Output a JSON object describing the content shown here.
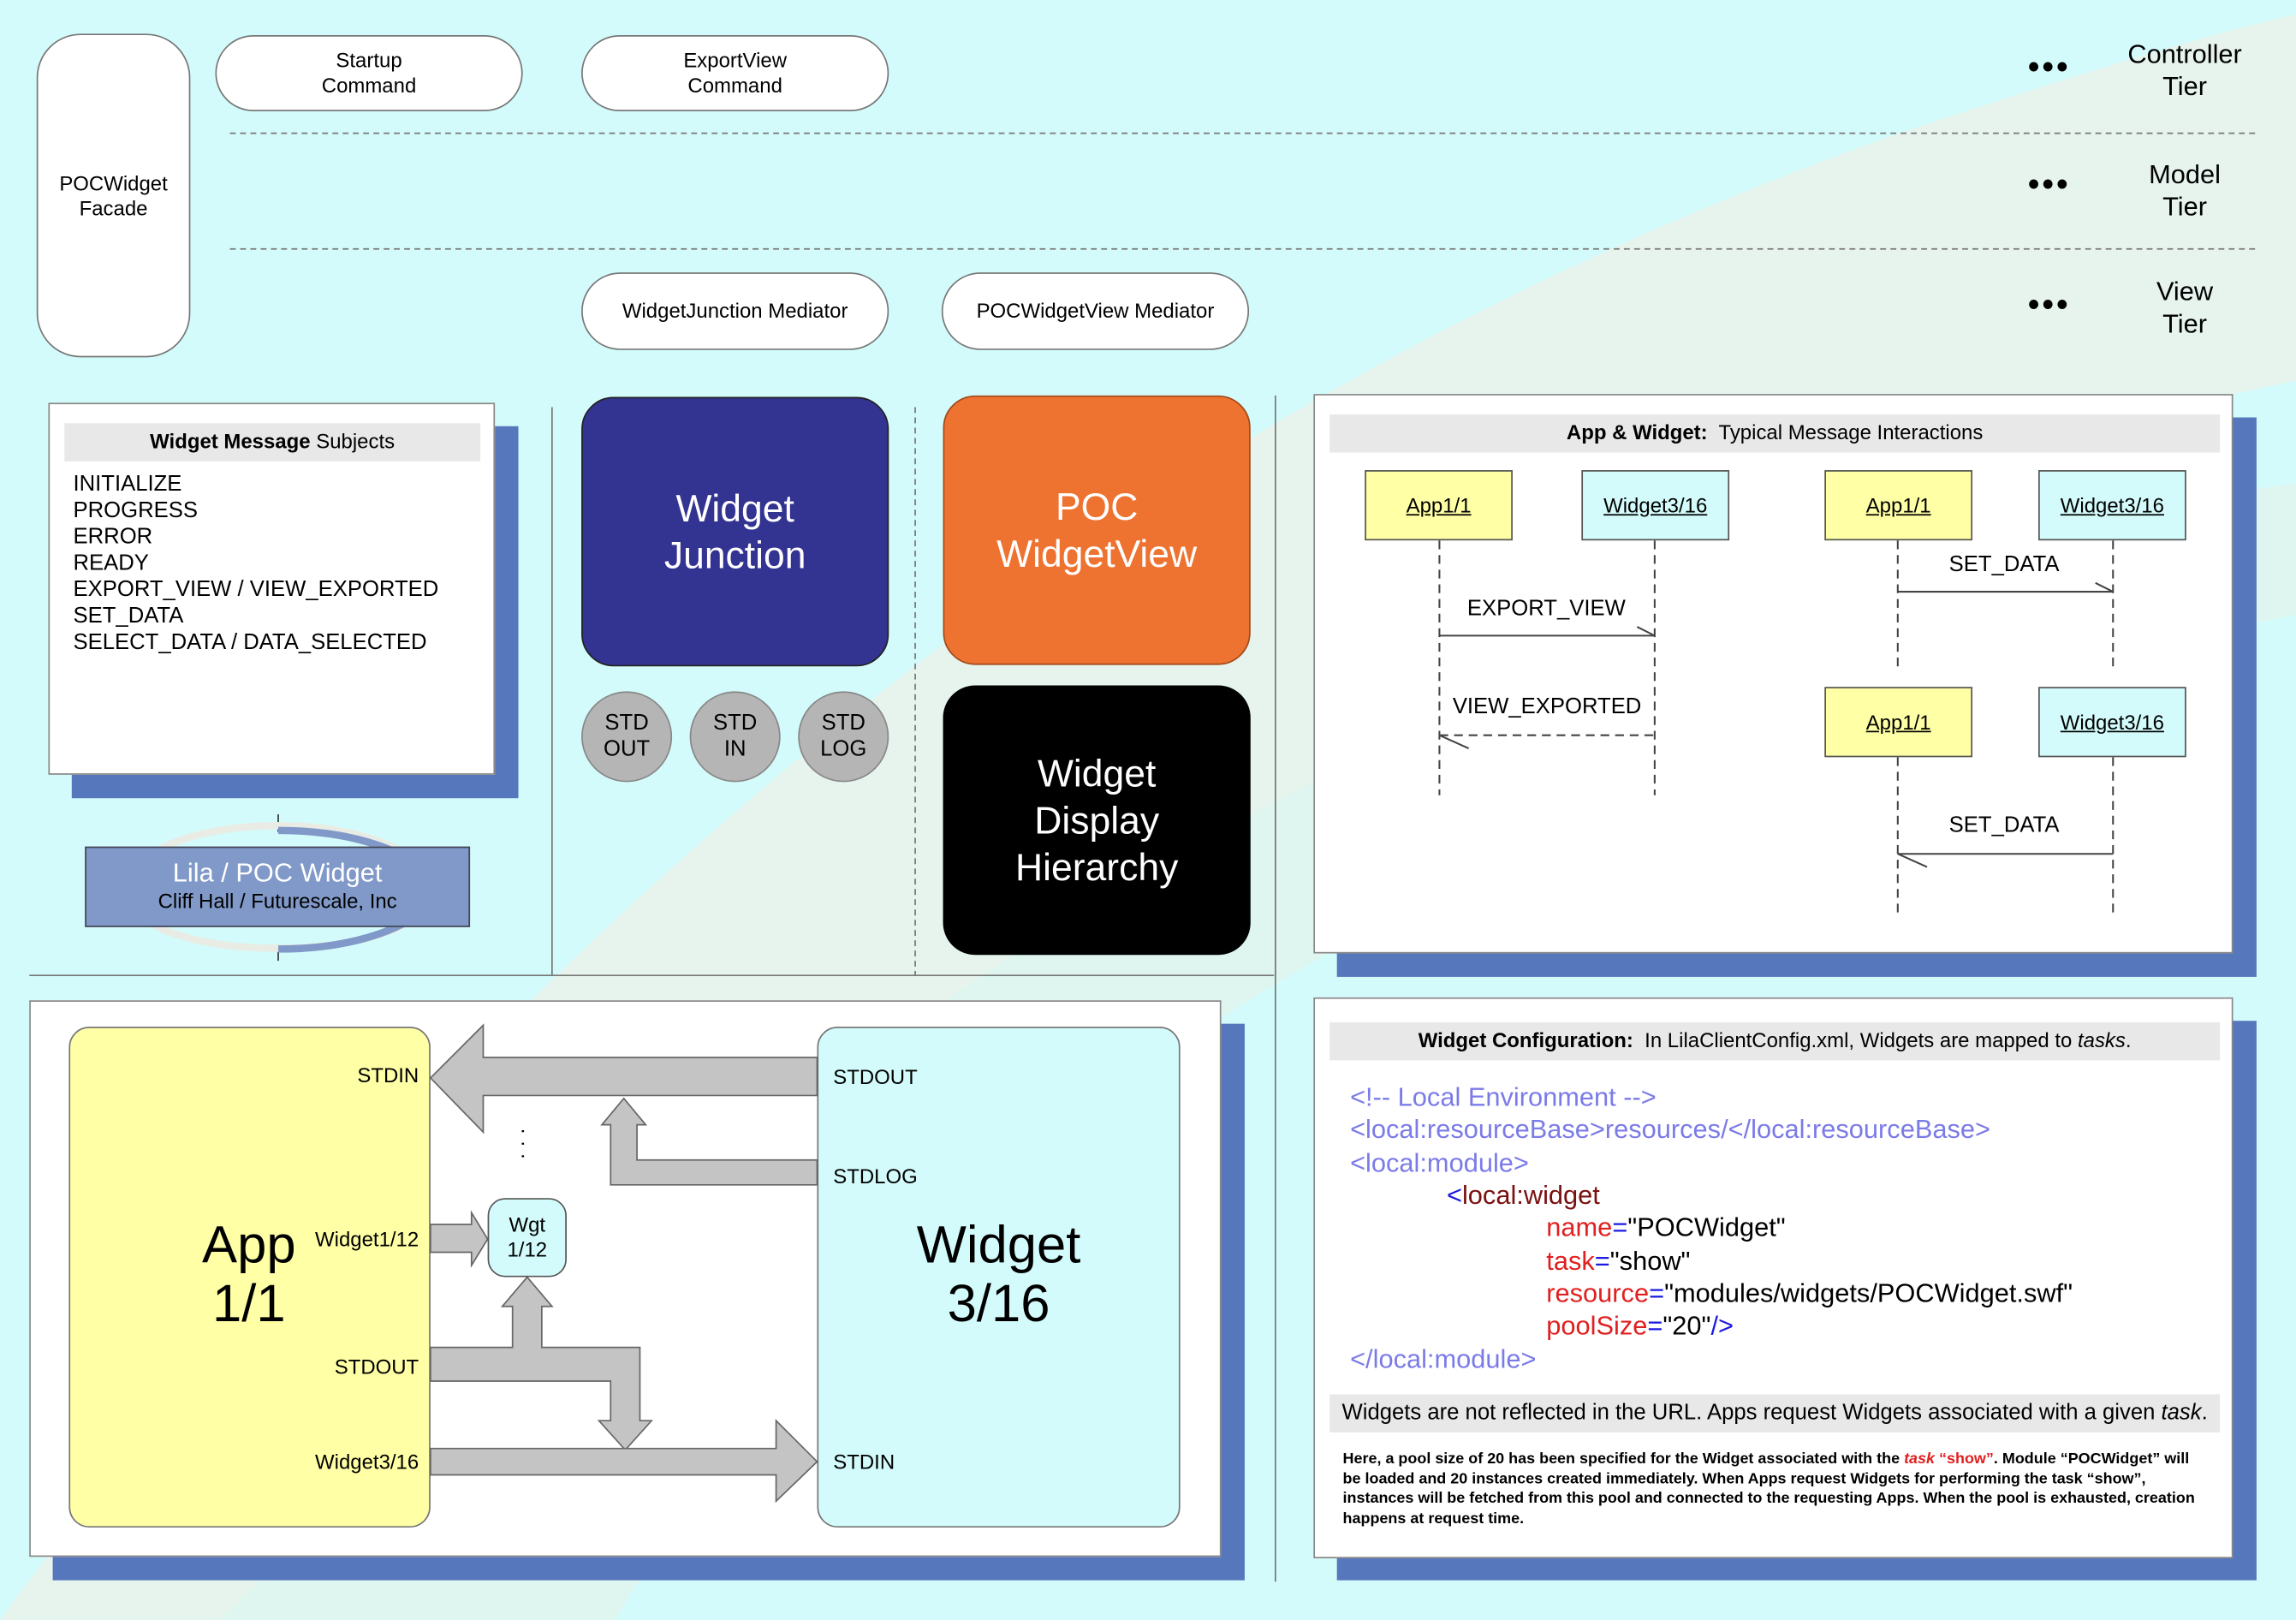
{
  "colors": {
    "background": "#d4fbfb",
    "swoosh": "#efefe2",
    "shadow": "#5677bc",
    "junction": "#333391",
    "widgetview": "#ee7230",
    "display": "#000000",
    "app": "#ffffa6",
    "widget": "#d4fbfb",
    "std": "#b5b5b5",
    "logo": "#8099c8"
  },
  "facade": "POCWidget\nFacade",
  "commands": [
    "Startup\nCommand",
    "ExportView\nCommand"
  ],
  "mediators": [
    "WidgetJunction Mediator",
    "POCWidgetView Mediator"
  ],
  "tiers": [
    {
      "dots": "•••",
      "label": "Controller\nTier"
    },
    {
      "dots": "•••",
      "label": "Model\nTier"
    },
    {
      "dots": "•••",
      "label": "View\nTier"
    }
  ],
  "subjects": {
    "title_bold": "Widget Message",
    "title_rest": " Subjects",
    "items": [
      "INITIALIZE",
      "PROGRESS",
      "ERROR",
      "READY",
      "EXPORT_VIEW / VIEW_EXPORTED",
      "SET_DATA",
      "SELECT_DATA / DATA_SELECTED"
    ]
  },
  "logo": {
    "title": "Lila / POC Widget",
    "subtitle": "Cliff Hall / Futurescale, Inc"
  },
  "blocks": {
    "junction": "Widget\nJunction",
    "widgetview": "POC\nWidgetView",
    "display": "Widget\nDisplay\nHierarchy",
    "std": [
      "STD\nOUT",
      "STD\nIN",
      "STD\nLOG"
    ]
  },
  "interactions": {
    "title_bold": "App & Widget:",
    "title_rest": "  Typical Message Interactions",
    "app": "App1/1",
    "widget": "Widget3/16",
    "export_view": "EXPORT_VIEW",
    "view_exported": "VIEW_EXPORTED",
    "set_data": "SET_DATA"
  },
  "flow": {
    "app": "App\n1/1",
    "widget": "Widget\n3/16",
    "app_ports": [
      "STDIN",
      "Widget1/12",
      "STDOUT",
      "Widget3/16"
    ],
    "widget_ports": [
      "STDOUT",
      "STDLOG",
      "STDIN"
    ],
    "wgt": "Wgt\n1/12",
    "dots": "· · ·"
  },
  "config": {
    "title_bold": "Widget Configuration:",
    "title_rest": "  In LilaClientConfig.xml, Widgets are mapped to ",
    "title_em": "tasks",
    "comment": "<!-- Local Environment -->",
    "resource_base": "<local:resourceBase>resources/</local:resourceBase>",
    "module_open": "<local:module>",
    "widget_lt": "<",
    "widget_tag": "local:widget",
    "attrs": [
      {
        "name": "name",
        "value": "\"POCWidget\""
      },
      {
        "name": "task",
        "value": "\"show\""
      },
      {
        "name": "resource",
        "value": "\"modules/widgets/POCWidget.swf\""
      },
      {
        "name": "poolSize",
        "value": "\"20\""
      }
    ],
    "close_self": "/>",
    "module_close": "</local:module>",
    "note": "Widgets are not reflected in the URL. Apps request Widgets associated with a given ",
    "note_em": "task",
    "para_a": "Here, a pool size of 20 has been specified for the Widget associated with the ",
    "para_task": "task",
    "para_show": " “show”",
    "para_b": ". Module “POCWidget” will be loaded and 20 instances created immediately. When Apps request Widgets for performing the task “show”, instances will be fetched from this pool and connected to the requesting Apps. When the pool is exhausted, creation happens at request time."
  }
}
